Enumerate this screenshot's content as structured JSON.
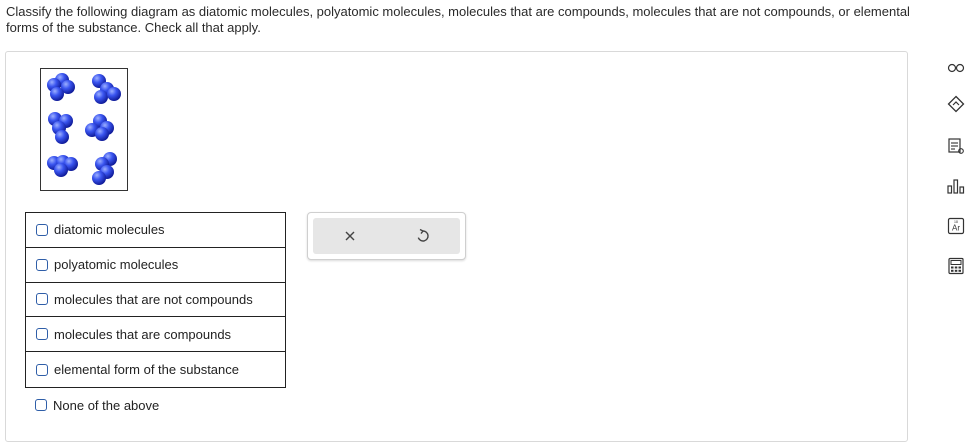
{
  "question": {
    "text": "Classify the following diagram as diatomic molecules, polyatomic molecules, molecules that are compounds, molecules that are not compounds, or elemental forms of the substance. Check all that apply."
  },
  "options": [
    {
      "label": "diatomic molecules",
      "checked": false
    },
    {
      "label": "polyatomic molecules",
      "checked": false
    },
    {
      "label": "molecules that are not compounds",
      "checked": false
    },
    {
      "label": "molecules that are compounds",
      "checked": false
    },
    {
      "label": "elemental form of the substance",
      "checked": false
    }
  ],
  "none_option": {
    "label": "None of the above",
    "checked": false
  },
  "tools": [
    {
      "name": "clear-icon",
      "glyph": "×"
    },
    {
      "name": "undo-icon",
      "glyph": "↺"
    }
  ],
  "sidebar_icons": [
    "glasses-icon",
    "hint-icon",
    "notes-icon",
    "chart-icon",
    "periodic-table-icon",
    "calculator-icon"
  ],
  "colors": {
    "atom": "#2f4be0",
    "accent": "#2f5ea8"
  }
}
